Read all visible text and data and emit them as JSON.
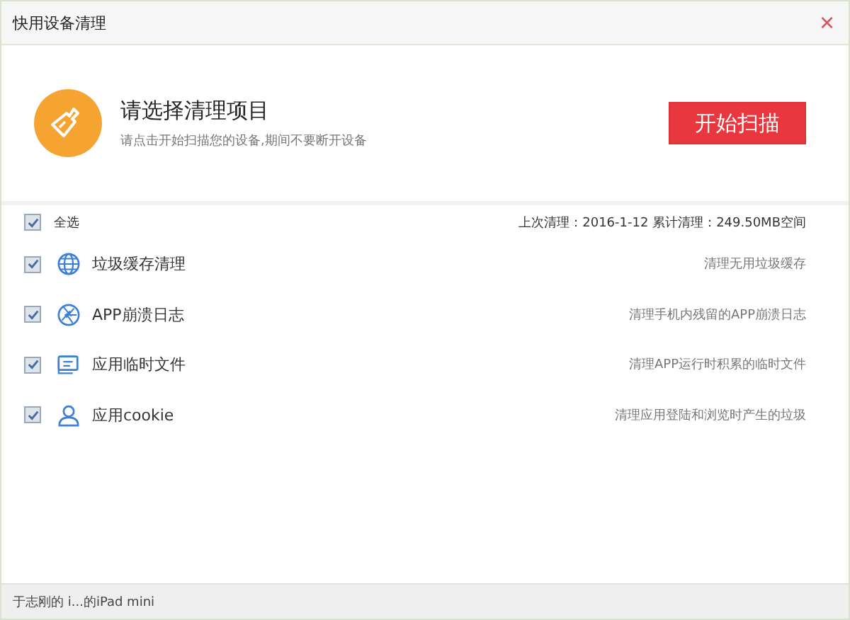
{
  "window": {
    "title": "快用设备清理",
    "close": "×"
  },
  "header": {
    "title": "请选择清理项目",
    "subtitle": "请点击开始扫描您的设备,期间不要断开设备",
    "scan_button": "开始扫描"
  },
  "select_all": {
    "label": "全选",
    "checked": true
  },
  "summary": "上次清理：2016-1-12 累计清理：249.50MB空间",
  "items": [
    {
      "kind": "cache",
      "label": "垃圾缓存清理",
      "description": "清理无用垃圾缓存",
      "checked": true
    },
    {
      "kind": "crash",
      "label": "APP崩溃日志",
      "description": "清理手机内残留的APP崩溃日志",
      "checked": true
    },
    {
      "kind": "temp",
      "label": "应用临时文件",
      "description": "清理APP运行时积累的临时文件",
      "checked": true
    },
    {
      "kind": "cookie",
      "label": "应用cookie",
      "description": "清理应用登陆和浏览时产生的垃圾",
      "checked": true
    }
  ],
  "status_bar": "于志刚的 i...的iPad mini"
}
